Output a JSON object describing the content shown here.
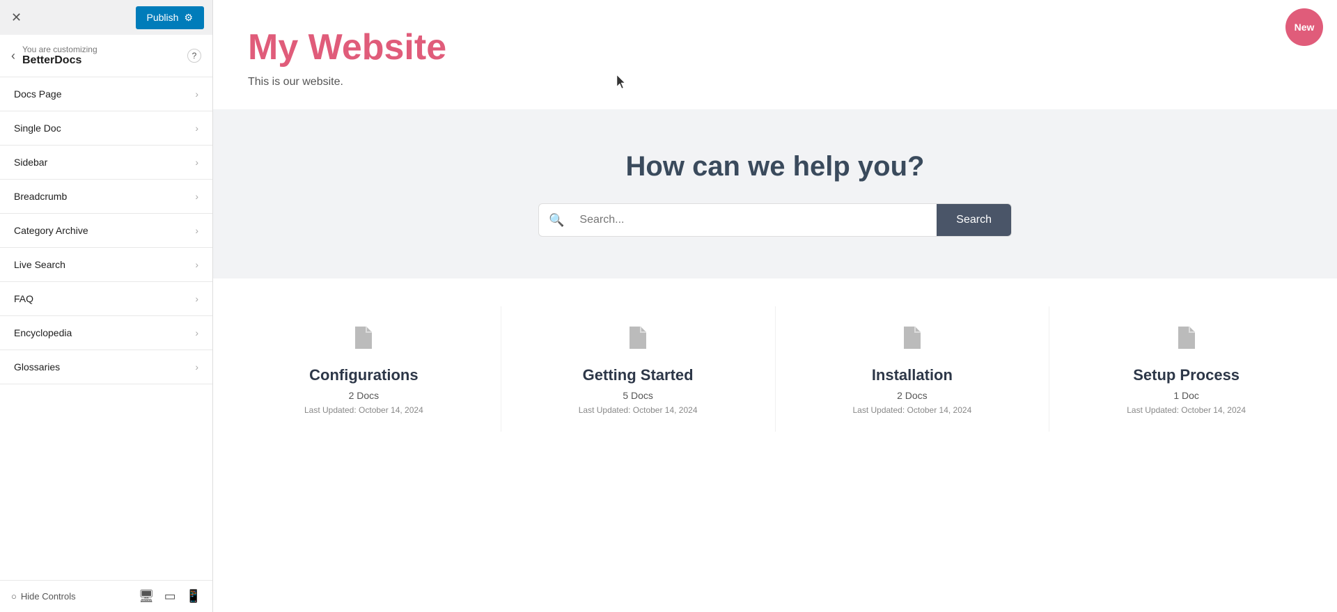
{
  "topbar": {
    "publish_label": "Publish",
    "gear_icon": "⚙",
    "close_icon": "✕"
  },
  "sidebar_header": {
    "customizing_label": "You are customizing",
    "site_name": "BetterDocs",
    "back_icon": "‹",
    "help_icon": "?"
  },
  "nav_items": [
    {
      "label": "Docs Page"
    },
    {
      "label": "Single Doc"
    },
    {
      "label": "Sidebar"
    },
    {
      "label": "Breadcrumb"
    },
    {
      "label": "Category Archive"
    },
    {
      "label": "Live Search"
    },
    {
      "label": "FAQ"
    },
    {
      "label": "Encyclopedia"
    },
    {
      "label": "Glossaries"
    }
  ],
  "footer": {
    "hide_controls_label": "Hide Controls",
    "circle_icon": "○",
    "desktop_icon": "🖥",
    "tablet_icon": "▭",
    "mobile_icon": "📱"
  },
  "hero": {
    "site_title": "My Website",
    "site_subtitle": "This is our website."
  },
  "search_section": {
    "heading": "How can we help you?",
    "input_placeholder": "Search...",
    "button_label": "Search"
  },
  "cards": [
    {
      "title": "Configurations",
      "count": "2 Docs",
      "updated": "Last Updated: October 14, 2024"
    },
    {
      "title": "Getting Started",
      "count": "5 Docs",
      "updated": "Last Updated: October 14, 2024"
    },
    {
      "title": "Installation",
      "count": "2 Docs",
      "updated": "Last Updated: October 14, 2024"
    },
    {
      "title": "Setup Process",
      "count": "1 Doc",
      "updated": "Last Updated: October 14, 2024"
    }
  ],
  "new_badge": {
    "label": "New"
  }
}
